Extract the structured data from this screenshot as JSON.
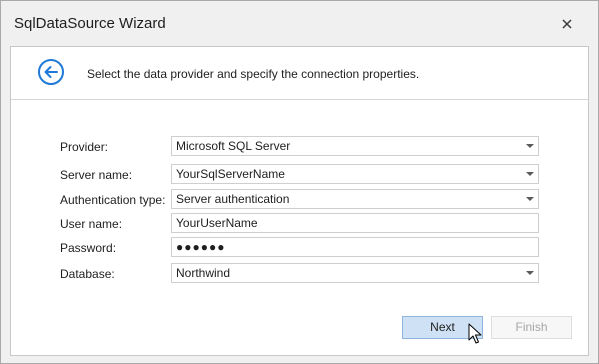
{
  "window": {
    "title": "SqlDataSource Wizard",
    "close_icon": "close-icon"
  },
  "header": {
    "back_icon": "back-arrow-icon",
    "instruction": "Select the data provider and specify the connection properties."
  },
  "form": {
    "provider": {
      "label": "Provider:",
      "value": "Microsoft SQL Server"
    },
    "server": {
      "label": "Server name:",
      "value": "YourSqlServerName"
    },
    "auth": {
      "label": "Authentication type:",
      "value": "Server authentication"
    },
    "user": {
      "label": "User name:",
      "value": "YourUserName"
    },
    "password": {
      "label": "Password:",
      "value": "●●●●●●"
    },
    "database": {
      "label": "Database:",
      "value": "Northwind"
    }
  },
  "buttons": {
    "next": "Next",
    "finish": "Finish"
  },
  "colors": {
    "accent": "#1e7ad6",
    "next_bg": "#cfe1f5",
    "next_border": "#8fb5de"
  }
}
